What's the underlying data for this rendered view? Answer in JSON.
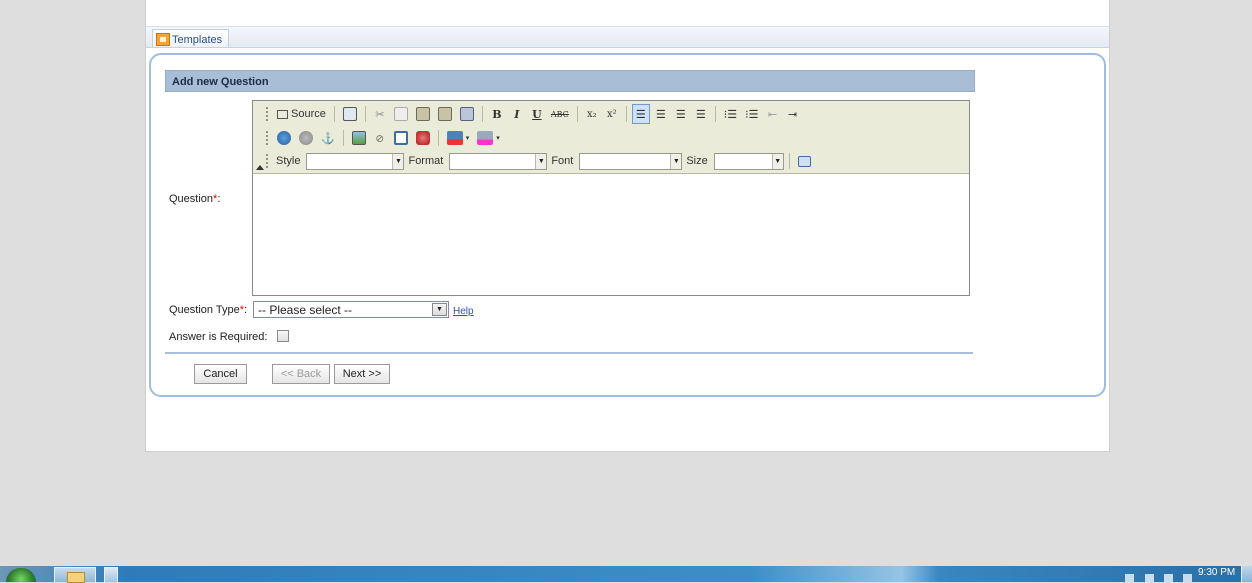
{
  "tabs": [
    {
      "label": "Templates",
      "icon": "templates-icon"
    }
  ],
  "form": {
    "header": "Add new Question",
    "question_label": "Question",
    "question_type_label": "Question Type",
    "required_marker": "*",
    "label_colon": ":",
    "question_type_value": "-- Please select --",
    "help_link": "Help",
    "answer_required_label": "Answer is Required:",
    "answer_required_checked": false
  },
  "editor": {
    "source_label": "Source",
    "style_label": "Style",
    "format_label": "Format",
    "font_label": "Font",
    "size_label": "Size",
    "style_value": "",
    "format_value": "",
    "font_value": "",
    "size_value": "",
    "row1_buttons": [
      "source",
      "preview",
      "cut",
      "copy",
      "paste",
      "paste-text",
      "paste-word",
      "bold",
      "italic",
      "underline",
      "strikethrough",
      "subscript",
      "superscript",
      "align-left",
      "align-center",
      "align-right",
      "justify",
      "numbered-list",
      "bulleted-list",
      "outdent",
      "indent"
    ],
    "row2_buttons": [
      "link",
      "unlink",
      "anchor",
      "image",
      "flash",
      "table",
      "special-char",
      "text-color",
      "background-color"
    ],
    "glyphs": {
      "bold": "B",
      "italic": "I",
      "underline": "U",
      "strike": "ABC",
      "sub": "x₂",
      "sup": "x²",
      "cut": "✂",
      "anchor": "⚓",
      "flash": "⊘"
    }
  },
  "buttons": {
    "cancel": "Cancel",
    "back": "<< Back",
    "next": "Next >>"
  },
  "taskbar": {
    "clock": "9:30 PM"
  },
  "colors": {
    "header_bg": "#a8bdd6",
    "panel_border": "#9fbde0",
    "toolbar_bg": "#eaecd9",
    "required": "#dd0000",
    "link": "#2d4fbf"
  }
}
